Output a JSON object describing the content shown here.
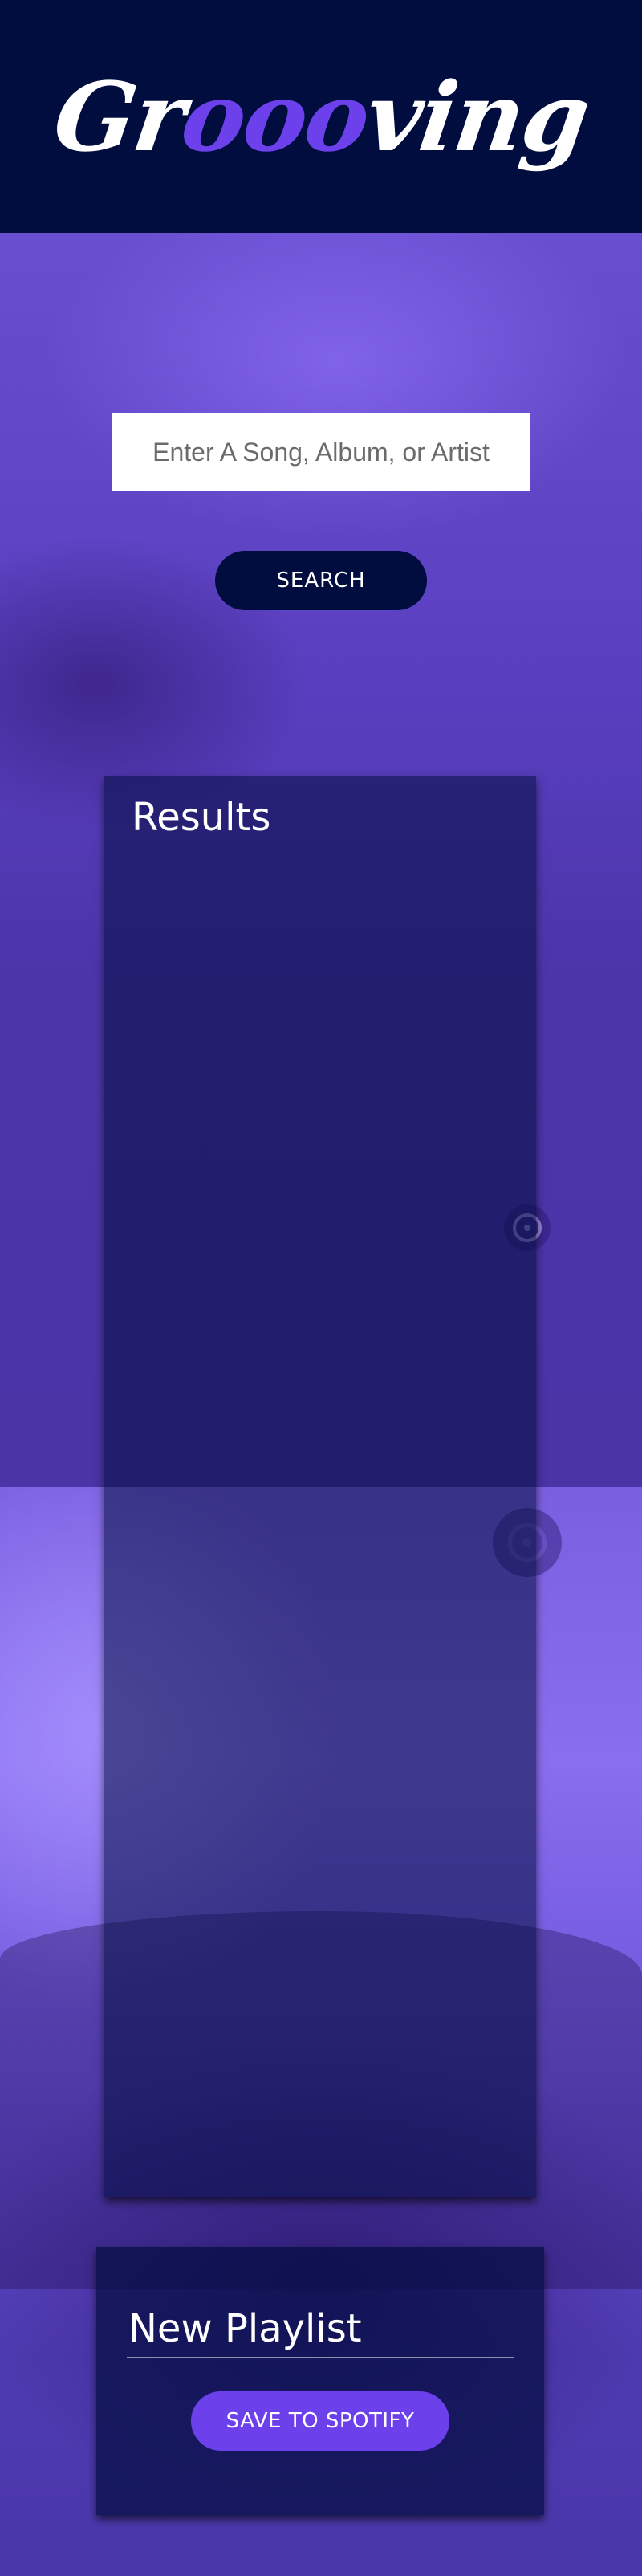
{
  "app": {
    "logo_part1": "Gr",
    "logo_accent": "ooo",
    "logo_part2": "ving"
  },
  "search": {
    "placeholder": "Enter A Song, Album, or Artist",
    "value": "",
    "button_label": "SEARCH"
  },
  "results": {
    "title": "Results",
    "tracks": []
  },
  "playlist": {
    "name": "New Playlist",
    "tracks": [],
    "save_label": "SAVE TO SPOTIFY"
  },
  "colors": {
    "header_bg": "#010c3f",
    "accent": "#6c41ec",
    "panel_bg": "#010c3f",
    "text": "#ffffff"
  },
  "icons": [
    "vinyl-record-icon"
  ]
}
